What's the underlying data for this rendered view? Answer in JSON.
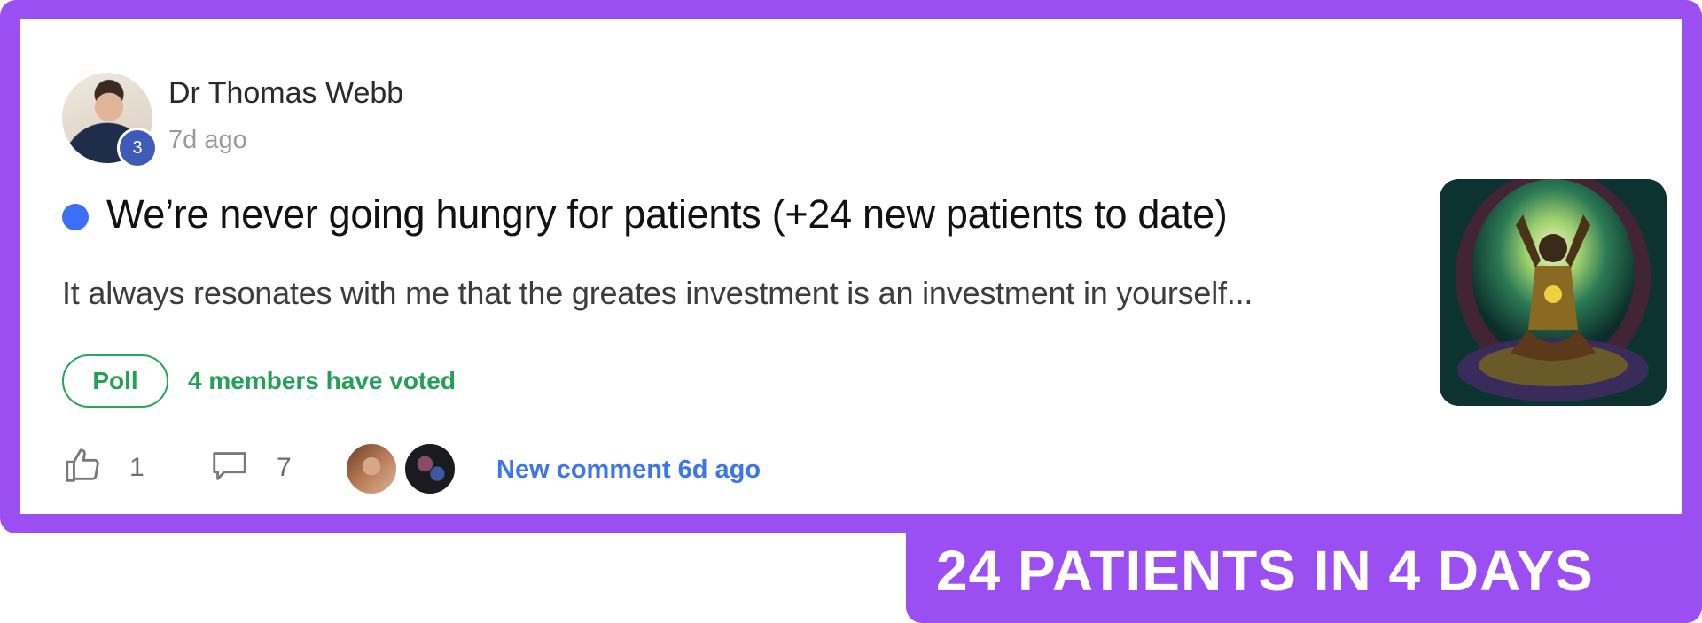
{
  "post": {
    "author": "Dr Thomas Webb",
    "author_level": "3",
    "time": "7d ago",
    "title": "We’re never going hungry for patients (+24 new patients to date)",
    "excerpt": "It always resonates with me that the greates investment is an investment in yourself...",
    "poll_label": "Poll",
    "poll_status": "4 members have voted",
    "likes": "1",
    "comments": "7",
    "last_comment": "New comment 6d ago"
  },
  "banner": {
    "text": "24 PATIENTS IN 4 DAYS"
  },
  "colors": {
    "frame": "#9b4ff2",
    "unread": "#3b6ff5",
    "poll": "#23a055",
    "link": "#3b76ea",
    "level_badge": "#3f5bb8"
  },
  "icons": [
    "thumbs-up-icon",
    "comment-icon"
  ]
}
